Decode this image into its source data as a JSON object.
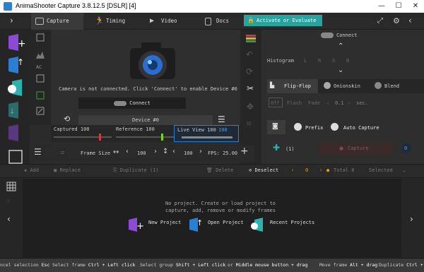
{
  "window": {
    "title": "AnimaShooter Capture 3.8.12.5 [DSLR] [4]",
    "minimize": "—",
    "maximize": "☐",
    "close": "✕"
  },
  "tabs": [
    {
      "label": "Capture"
    },
    {
      "label": "Timing"
    },
    {
      "label": "Video"
    },
    {
      "label": "Docs"
    }
  ],
  "activate_label": "Activate or Evaluate",
  "viewer": {
    "status": "Camera is not connected. Click 'Connect' to enable Device #0",
    "connect_label": "Connect",
    "device_label": "Device #0"
  },
  "sliders": {
    "captured": "Captured 100",
    "reference": "Reference 100",
    "live_view": "Live View 100",
    "live_view_value": "100",
    "live_view_value2": "100"
  },
  "frame": {
    "size_label": "Frame Size",
    "width": "100",
    "height": "100",
    "fps": "FPS: 25.00"
  },
  "right": {
    "connect_label": "Connect",
    "histogram_label": "Histogram",
    "histogram_channels": [
      "L",
      "R",
      "G",
      "B"
    ],
    "tabs": [
      "Flip-Flop",
      "Onionskin",
      "Blend"
    ],
    "flash": {
      "off": "Off",
      "flash": "Flash",
      "fade": "Fade",
      "value": "0.1",
      "unit": "sec."
    },
    "prefix_label": "Prefix",
    "auto_capture_label": "Auto Capture",
    "capture_count": "(1)",
    "capture_label": "Capture",
    "capture_badge": "0"
  },
  "actions": {
    "add": "Add",
    "replace": "Replace",
    "duplicate": "Duplicate (1)",
    "delete": "Delete",
    "deselect": "Deselect",
    "current": "0",
    "total": "Total 0",
    "selected": "Selected"
  },
  "project": {
    "message_line1": "No project. Create or load project to",
    "message_line2": "capture, add, remove or modify frames",
    "new_project": "New Project",
    "open_project": "Open Project",
    "recent_projects": "Recent Projects"
  },
  "status": [
    {
      "label": "ncel selection",
      "key": "Esc"
    },
    {
      "label": "Select frame",
      "key": "Ctrl + Left click"
    },
    {
      "label": "Select group",
      "key": "Shift + Left click"
    },
    {
      "label": "or",
      "key": "Middle mouse button + drag"
    },
    {
      "label": "Move frame",
      "key": "Alt + drag"
    },
    {
      "label": "Duplicate",
      "key": "Ctrl +"
    }
  ],
  "colors": {
    "accent": "#27a3a0",
    "purple": "#8b4bd6",
    "blue": "#2a7fd4",
    "teal": "#2bb3b0",
    "red": "#d23a3a",
    "green": "#7ed321"
  }
}
